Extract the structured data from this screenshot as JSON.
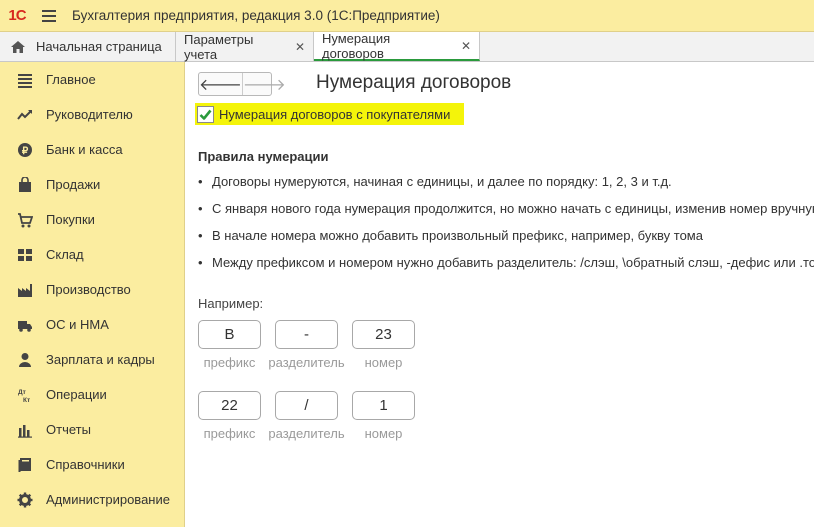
{
  "app": {
    "logo_text": "1С",
    "title": "Бухгалтерия предприятия, редакция 3.0  (1С:Предприятие)"
  },
  "tabs": [
    {
      "label": "Начальная страница",
      "icon": "home-icon",
      "closable": false,
      "active": false
    },
    {
      "label": "Параметры учета",
      "closable": true,
      "active": false
    },
    {
      "label": "Нумерация договоров",
      "closable": true,
      "active": true
    }
  ],
  "tab_close_glyph": "✕",
  "sidebar": {
    "items": [
      {
        "label": "Главное",
        "icon": "list-icon"
      },
      {
        "label": "Руководителю",
        "icon": "trend-icon"
      },
      {
        "label": "Банк и касса",
        "icon": "coin-icon"
      },
      {
        "label": "Продажи",
        "icon": "bag-icon"
      },
      {
        "label": "Покупки",
        "icon": "cart-icon"
      },
      {
        "label": "Склад",
        "icon": "warehouse-icon"
      },
      {
        "label": "Производство",
        "icon": "factory-icon"
      },
      {
        "label": "ОС и НМА",
        "icon": "truck-icon"
      },
      {
        "label": "Зарплата и кадры",
        "icon": "person-icon"
      },
      {
        "label": "Операции",
        "icon": "dt-kt-icon"
      },
      {
        "label": "Отчеты",
        "icon": "bar-chart-icon"
      },
      {
        "label": "Справочники",
        "icon": "book-icon"
      },
      {
        "label": "Администрирование",
        "icon": "gear-icon"
      }
    ]
  },
  "nav": {
    "back_glyph": "🡐",
    "forward_glyph": "🡒"
  },
  "page": {
    "title": "Нумерация договоров",
    "checkbox_label": "Нумерация договоров с покупателями",
    "checkbox_checked": true,
    "rules_title": "Правила нумерации",
    "rules": [
      "Договоры нумеруются, начиная с единицы, и далее по порядку: 1, 2, 3 и т.д.",
      "С января нового года нумерация продолжится, но можно начать с единицы, изменив номер вручную",
      "В начале номера можно добавить произвольный префикс, например, букву тома",
      "Между префиксом и номером нужно добавить разделитель: /слэш, \\обратный слэш, -дефис или .точку"
    ],
    "example_label": "Например:",
    "examples": [
      {
        "prefix": "В",
        "separator": "-",
        "number": "23"
      },
      {
        "prefix": "22",
        "separator": "/",
        "number": "1"
      }
    ],
    "captions": {
      "prefix": "префикс",
      "separator": "разделитель",
      "number": "номер"
    }
  },
  "colors": {
    "sidebar_bg": "#fbeda0",
    "highlight": "#f4f40a",
    "check_green": "#2a9a3c",
    "logo_red": "#d72a20"
  }
}
